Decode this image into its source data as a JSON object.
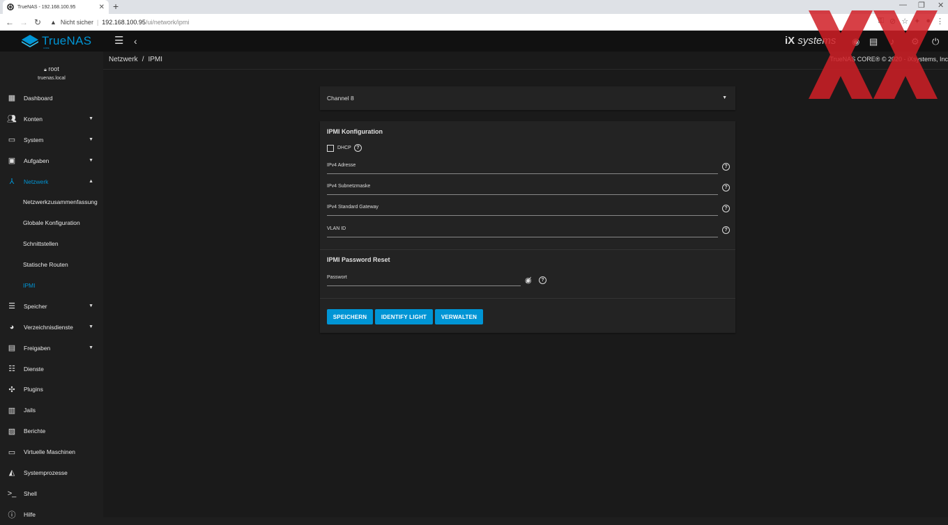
{
  "browser": {
    "tab_title": "TrueNAS - 192.168.100.95",
    "security_label": "Nicht sicher",
    "url_host": "192.168.100.95",
    "url_path": "/ui/network/ipmi"
  },
  "topbar": {
    "logo_text": "TrueNAS",
    "logo_sub": "CORE",
    "brand": "systems"
  },
  "user": {
    "name": "root",
    "host": "truenas.local"
  },
  "sidebar": {
    "items": [
      {
        "label": "Dashboard",
        "icon": "dashboard-icon"
      },
      {
        "label": "Konten",
        "icon": "people-icon"
      },
      {
        "label": "System",
        "icon": "laptop-icon"
      },
      {
        "label": "Aufgaben",
        "icon": "calendar-icon"
      },
      {
        "label": "Netzwerk",
        "icon": "network-icon"
      },
      {
        "label": "Netzwerkzusammenfassung"
      },
      {
        "label": "Globale Konfiguration"
      },
      {
        "label": "Schnittstellen"
      },
      {
        "label": "Statische Routen"
      },
      {
        "label": "IPMI"
      },
      {
        "label": "Speicher",
        "icon": "storage-icon"
      },
      {
        "label": "Verzeichnisdienste",
        "icon": "directory-icon"
      },
      {
        "label": "Freigaben",
        "icon": "share-icon"
      },
      {
        "label": "Dienste",
        "icon": "tune-icon"
      },
      {
        "label": "Plugins",
        "icon": "puzzle-icon"
      },
      {
        "label": "Jails",
        "icon": "jail-icon"
      },
      {
        "label": "Berichte",
        "icon": "chart-icon"
      },
      {
        "label": "Virtuelle Maschinen",
        "icon": "computer-icon"
      },
      {
        "label": "Systemprozesse",
        "icon": "process-icon"
      },
      {
        "label": "Shell",
        "icon": "shell-icon"
      },
      {
        "label": "Hilfe",
        "icon": "help-icon"
      }
    ]
  },
  "breadcrumb": {
    "parent": "Netzwerk",
    "current": "IPMI"
  },
  "copyright": "TrueNAS CORE® © 2020 - iXsystems, Inc",
  "channel": {
    "value": "Channel 8"
  },
  "ipmi": {
    "title": "IPMI Konfiguration",
    "dhcp_label": "DHCP",
    "dhcp_checked": false,
    "fields": [
      {
        "label": "IPv4 Adresse"
      },
      {
        "label": "IPv4 Subnetzmaske"
      },
      {
        "label": "IPv4 Standard Gateway"
      },
      {
        "label": "VLAN ID"
      }
    ]
  },
  "password_reset": {
    "title": "IPMI Password Reset",
    "password_label": "Passwort"
  },
  "buttons": {
    "save": "SPEICHERN",
    "identify": "IDENTIFY LIGHT",
    "manage": "VERWALTEN"
  },
  "colors": {
    "accent": "#0095d5",
    "background": "#1a1a1a",
    "card": "#232323"
  }
}
